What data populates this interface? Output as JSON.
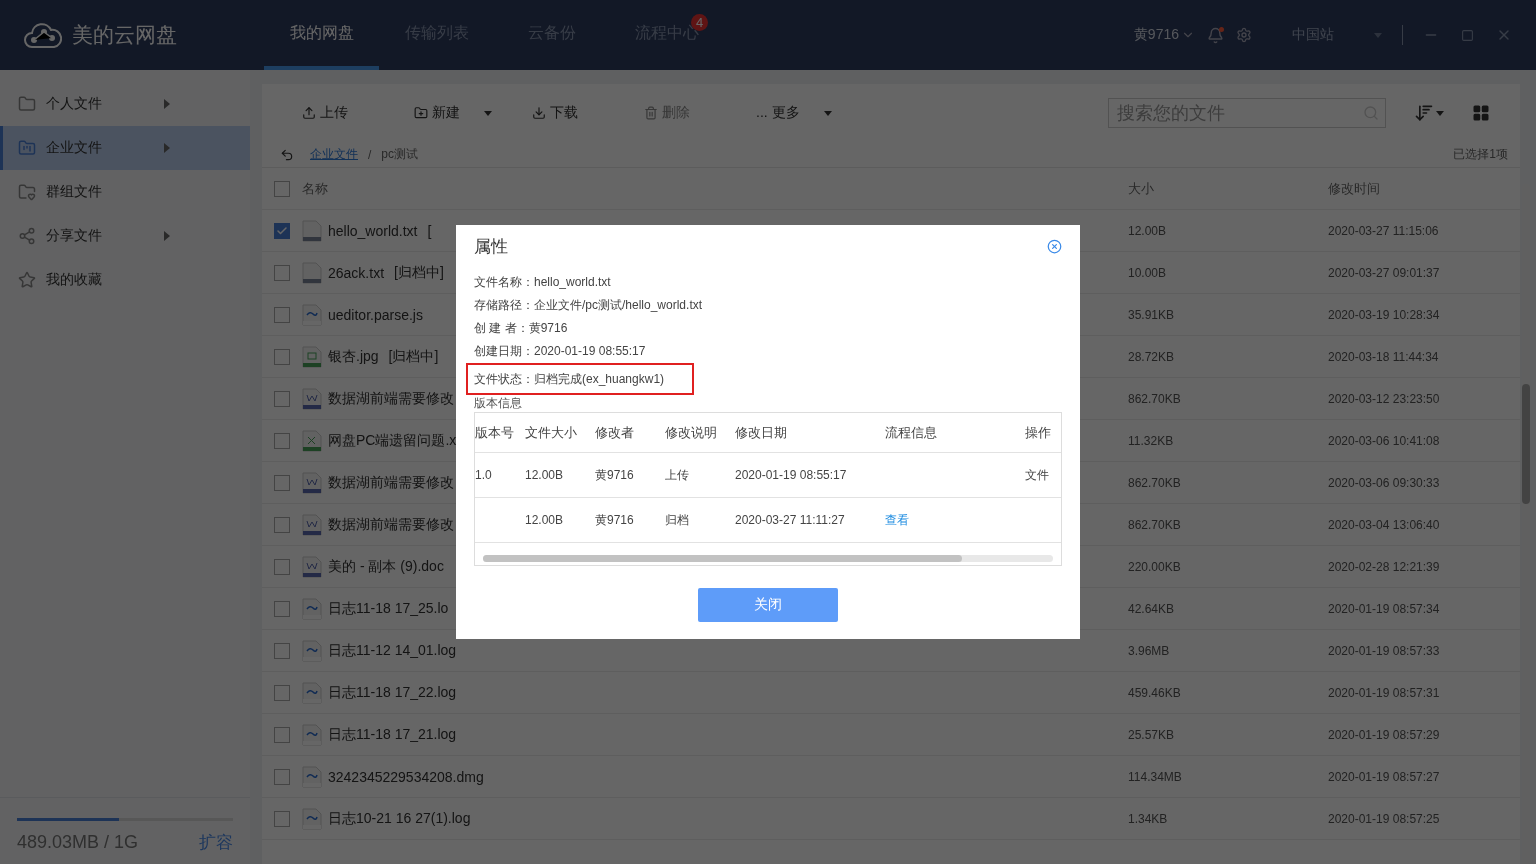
{
  "app": {
    "title": "美的云网盘",
    "user": "黄9716",
    "site": "中国站",
    "notification_dot": true
  },
  "nav_tabs": [
    {
      "label": "我的网盘",
      "selected": true
    },
    {
      "label": "传输列表",
      "selected": false
    },
    {
      "label": "云备份",
      "selected": false
    },
    {
      "label": "流程中心",
      "selected": false,
      "badge": "4"
    }
  ],
  "sidebar": {
    "items": [
      {
        "label": "个人文件",
        "kind": "folder",
        "expandable": true,
        "selected": false
      },
      {
        "label": "企业文件",
        "kind": "enterprise",
        "expandable": true,
        "selected": true
      },
      {
        "label": "群组文件",
        "kind": "group",
        "expandable": false,
        "selected": false
      },
      {
        "label": "分享文件",
        "kind": "share",
        "expandable": true,
        "selected": false
      },
      {
        "label": "我的收藏",
        "kind": "star",
        "expandable": false,
        "selected": false
      }
    ],
    "storage": {
      "level": 0.47,
      "text": "489.03MB / 1G",
      "action": "扩容"
    }
  },
  "toolbar": {
    "buttons": [
      {
        "label": "上传",
        "kind": "upload",
        "disabled": false,
        "dropdown": false
      },
      {
        "label": "新建",
        "kind": "new",
        "disabled": false,
        "dropdown": true
      },
      {
        "label": "下载",
        "kind": "download",
        "disabled": false,
        "dropdown": false
      },
      {
        "label": "删除",
        "kind": "delete",
        "disabled": true,
        "dropdown": false
      },
      {
        "label": "... 更多",
        "kind": "more",
        "disabled": false,
        "dropdown": true
      }
    ],
    "search": {
      "placeholder": "搜索您的文件"
    }
  },
  "breadcrumb": {
    "items": [
      {
        "label": "企业文件",
        "link": true
      },
      {
        "label": "pc测试",
        "link": false
      }
    ],
    "separator": "/",
    "selection": "已选择1项"
  },
  "table": {
    "columns": [
      "名称",
      "大小",
      "修改时间"
    ],
    "select_all": false,
    "rows": [
      {
        "name": "hello_world.txt",
        "tag": "[",
        "kind": "text",
        "size": "12.00B",
        "modified": "2020-03-27 11:15:06",
        "checked": true
      },
      {
        "name": "26ack.txt",
        "tag": "[归档中]",
        "kind": "text",
        "size": "10.00B",
        "modified": "2020-03-27 09:01:37",
        "checked": false
      },
      {
        "name": "ueditor.parse.js",
        "kind": "generic",
        "size": "35.91KB",
        "modified": "2020-03-19 10:28:34",
        "checked": false
      },
      {
        "name": "银杏.jpg",
        "tag": "[归档中]",
        "kind": "image",
        "size": "28.72KB",
        "modified": "2020-03-18 11:44:34",
        "checked": false
      },
      {
        "name": "数据湖前端需要修改",
        "kind": "word",
        "size": "862.70KB",
        "modified": "2020-03-12 23:23:50",
        "checked": false
      },
      {
        "name": "网盘PC端遗留问题.x",
        "kind": "excel",
        "size": "11.32KB",
        "modified": "2020-03-06 10:41:08",
        "checked": false
      },
      {
        "name": "数据湖前端需要修改",
        "kind": "word",
        "size": "862.70KB",
        "modified": "2020-03-06 09:30:33",
        "checked": false
      },
      {
        "name": "数据湖前端需要修改",
        "kind": "word",
        "size": "862.70KB",
        "modified": "2020-03-04 13:06:40",
        "checked": false
      },
      {
        "name": "美的 - 副本 (9).doc",
        "kind": "word",
        "size": "220.00KB",
        "modified": "2020-02-28 12:21:39",
        "checked": false
      },
      {
        "name": "日志11-18 17_25.lo",
        "kind": "generic",
        "size": "42.64KB",
        "modified": "2020-01-19 08:57:34",
        "checked": false
      },
      {
        "name": "日志11-12 14_01.log",
        "kind": "generic",
        "size": "3.96MB",
        "modified": "2020-01-19 08:57:33",
        "checked": false
      },
      {
        "name": "日志11-18 17_22.log",
        "kind": "generic",
        "size": "459.46KB",
        "modified": "2020-01-19 08:57:31",
        "checked": false
      },
      {
        "name": "日志11-18 17_21.log",
        "kind": "generic",
        "size": "25.57KB",
        "modified": "2020-01-19 08:57:29",
        "checked": false
      },
      {
        "name": "3242345229534208.dmg",
        "kind": "generic",
        "size": "114.34MB",
        "modified": "2020-01-19 08:57:27",
        "checked": false
      },
      {
        "name": "日志10-21 16 27(1).log",
        "kind": "generic",
        "size": "1.34KB",
        "modified": "2020-01-19 08:57:25",
        "checked": false
      }
    ]
  },
  "dialog": {
    "title": "属性",
    "fields": [
      {
        "label": "文件名称：",
        "value": "hello_world.txt",
        "highlighted": false
      },
      {
        "label": "存储路径：",
        "value": "企业文件/pc测试/hello_world.txt",
        "highlighted": false
      },
      {
        "label": "创 建 者：",
        "value": "黄9716",
        "highlighted": false
      },
      {
        "label": "创建日期：",
        "value": "2020-01-19 08:55:17",
        "highlighted": false
      },
      {
        "label": "文件状态：",
        "value": "归档完成(ex_huangkw1)",
        "highlighted": true
      }
    ],
    "section": "版本信息",
    "versions": {
      "columns": [
        "版本号",
        "文件大小",
        "修改者",
        "修改说明",
        "修改日期",
        "流程信息",
        "操作"
      ],
      "rows": [
        [
          "1.0",
          "12.00B",
          "黄9716",
          "上传",
          "2020-01-19 08:55:17",
          "",
          "文件"
        ],
        [
          "",
          "12.00B",
          "黄9716",
          "归档",
          "2020-03-27 11:11:27",
          "查看",
          ""
        ]
      ]
    },
    "button": "关闭"
  }
}
